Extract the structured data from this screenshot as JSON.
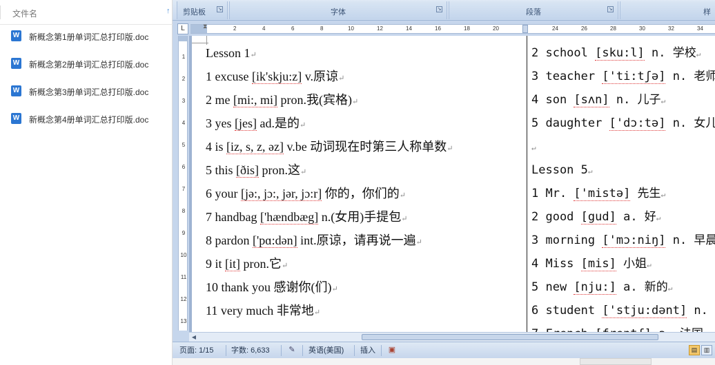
{
  "file_pane": {
    "column_label": "文件名",
    "sort_icon": "up-arrow-icon",
    "files": [
      {
        "icon": "word-doc-icon",
        "icon_glyph": "W",
        "name": "新概念第1册单词汇总打印版.doc"
      },
      {
        "icon": "word-doc-icon",
        "icon_glyph": "W",
        "name": "新概念第2册单词汇总打印版.doc"
      },
      {
        "icon": "word-doc-icon",
        "icon_glyph": "W",
        "name": "新概念第3册单词汇总打印版.doc"
      },
      {
        "icon": "word-doc-icon",
        "icon_glyph": "W",
        "name": "新概念第4册单词汇总打印版.doc"
      }
    ]
  },
  "ribbon": {
    "groups": [
      "剪贴板",
      "字体",
      "段落",
      "样"
    ],
    "launcher_glyph": "↘"
  },
  "ruler": {
    "tab_selector_glyph": "L",
    "ticks": [
      "2",
      "4",
      "6",
      "8",
      "10",
      "12",
      "14",
      "16",
      "18",
      "20",
      "24",
      "26",
      "28",
      "30",
      "32",
      "34"
    ],
    "indent_glyph": "⧗"
  },
  "vertical_ruler": {
    "ticks": [
      "1",
      "2",
      "3",
      "4",
      "5",
      "6",
      "7",
      "8",
      "9",
      "10",
      "11",
      "12",
      "13"
    ]
  },
  "document": {
    "paragraph_mark": "↵",
    "column1": [
      {
        "num": "Lesson 1",
        "ipa": "",
        "meaning": ""
      },
      {
        "num": "1  excuse  ",
        "ipa": "[ik'skju:z]",
        "meaning": " v.原谅"
      },
      {
        "num": "2  me  ",
        "ipa": "[mi:, mi]",
        "meaning": " pron.我(宾格)"
      },
      {
        "num": "3  yes  ",
        "ipa": "[jes]",
        "meaning": " ad.是的"
      },
      {
        "num": "4  is  ",
        "ipa": "[iz, s, z, əz]",
        "meaning": " v.be 动词现在时第三人称单数"
      },
      {
        "num": "5  this  ",
        "ipa": "[ðis]",
        "meaning": " pron.这"
      },
      {
        "num": "6  your  ",
        "ipa": "[jə:, jɔ:, jər, jɔ:r]",
        "meaning": "  你的，你们的"
      },
      {
        "num": "7  handbag  ",
        "ipa": "['hændbæg]",
        "meaning": " n.(女用)手提包"
      },
      {
        "num": "8  pardon  ",
        "ipa": "['pɑ:dən]",
        "meaning": " int.原谅，请再说一遍"
      },
      {
        "num": "9  it  ",
        "ipa": "[it]",
        "meaning": " pron.它"
      },
      {
        "num": "10  thank you  ",
        "ipa": "",
        "meaning": "感谢你(们)"
      },
      {
        "num": "11 very much  ",
        "ipa": "",
        "meaning": "非常地"
      }
    ],
    "column2": [
      {
        "num": "2 school ",
        "ipa": "[sku:l]",
        "meaning": " n. 学校"
      },
      {
        "num": "3 teacher ",
        "ipa": "['ti:tʃə]",
        "meaning": " n. 老师"
      },
      {
        "num": "4 son ",
        "ipa": "[sʌn]",
        "meaning": " n. 儿子"
      },
      {
        "num": "5 daughter ",
        "ipa": "['dɔ:tə]",
        "meaning": " n. 女儿"
      },
      {
        "num": "",
        "ipa": "",
        "meaning": ""
      },
      {
        "num": "Lesson 5",
        "ipa": "",
        "meaning": ""
      },
      {
        "num": "1 Mr. ",
        "ipa": "['mistə]",
        "meaning": " 先生"
      },
      {
        "num": "2 good ",
        "ipa": "[gud]",
        "meaning": " a. 好"
      },
      {
        "num": "3 morning ",
        "ipa": "['mɔ:niŋ]",
        "meaning": " n. 早晨"
      },
      {
        "num": "4 Miss ",
        "ipa": "[mis]",
        "meaning": " 小姐"
      },
      {
        "num": "5 new ",
        "ipa": "[nju:]",
        "meaning": " a. 新的"
      },
      {
        "num": "6 student ",
        "ipa": "['stju:dənt]",
        "meaning": " n. 学"
      },
      {
        "num": "7 French ",
        "ipa": "[frentʃ]",
        "meaning": " a. 法国"
      }
    ]
  },
  "statusbar": {
    "page": "页面: 1/15",
    "words": "字数: 6,633",
    "language": "英语(美国)",
    "mode": "插入"
  }
}
